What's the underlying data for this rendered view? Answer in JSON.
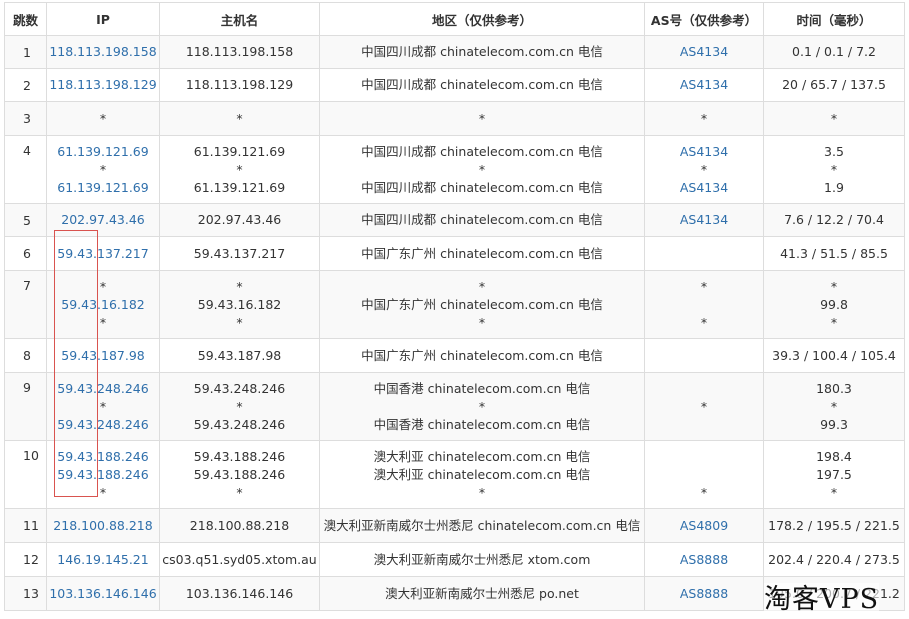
{
  "headers": {
    "hop": "跳数",
    "ip": "IP",
    "host": "主机名",
    "region": "地区（仅供参考）",
    "asn": "AS号（仅供参考）",
    "time": "时间（毫秒）"
  },
  "rows": [
    {
      "hop": "1",
      "ips": [
        "118.113.198.158"
      ],
      "hosts": [
        "118.113.198.158"
      ],
      "regions": [
        "中国四川成都 chinatelecom.com.cn 电信"
      ],
      "asns": [
        "AS4134"
      ],
      "times": [
        "0.1 / 0.1 / 7.2"
      ]
    },
    {
      "hop": "2",
      "ips": [
        "118.113.198.129"
      ],
      "hosts": [
        "118.113.198.129"
      ],
      "regions": [
        "中国四川成都 chinatelecom.com.cn 电信"
      ],
      "asns": [
        "AS4134"
      ],
      "times": [
        "20 / 65.7 / 137.5"
      ]
    },
    {
      "hop": "3",
      "ips": [
        "*"
      ],
      "hosts": [
        "*"
      ],
      "regions": [
        "*"
      ],
      "asns": [
        "*"
      ],
      "times": [
        "*"
      ]
    },
    {
      "hop": "4",
      "ips": [
        "61.139.121.69",
        "*",
        "61.139.121.69"
      ],
      "hosts": [
        "61.139.121.69",
        "*",
        "61.139.121.69"
      ],
      "regions": [
        "中国四川成都 chinatelecom.com.cn 电信",
        "*",
        "中国四川成都 chinatelecom.com.cn 电信"
      ],
      "asns": [
        "AS4134",
        "*",
        "AS4134"
      ],
      "times": [
        "3.5",
        "*",
        "1.9"
      ]
    },
    {
      "hop": "5",
      "ips": [
        "202.97.43.46"
      ],
      "hosts": [
        "202.97.43.46"
      ],
      "regions": [
        "中国四川成都 chinatelecom.com.cn 电信"
      ],
      "asns": [
        "AS4134"
      ],
      "times": [
        "7.6 / 12.2 / 70.4"
      ]
    },
    {
      "hop": "6",
      "ips": [
        "59.43.137.217"
      ],
      "hosts": [
        "59.43.137.217"
      ],
      "regions": [
        "中国广东广州 chinatelecom.com.cn 电信"
      ],
      "asns": [
        ""
      ],
      "times": [
        "41.3 / 51.5 / 85.5"
      ]
    },
    {
      "hop": "7",
      "ips": [
        "*",
        "59.43.16.182",
        "*"
      ],
      "hosts": [
        "*",
        "59.43.16.182",
        "*"
      ],
      "regions": [
        "*",
        "中国广东广州 chinatelecom.com.cn 电信",
        "*"
      ],
      "asns": [
        "*",
        "",
        "*"
      ],
      "times": [
        "*",
        "99.8",
        "*"
      ]
    },
    {
      "hop": "8",
      "ips": [
        "59.43.187.98"
      ],
      "hosts": [
        "59.43.187.98"
      ],
      "regions": [
        "中国广东广州 chinatelecom.com.cn 电信"
      ],
      "asns": [
        ""
      ],
      "times": [
        "39.3 / 100.4 / 105.4"
      ]
    },
    {
      "hop": "9",
      "ips": [
        "59.43.248.246",
        "*",
        "59.43.248.246"
      ],
      "hosts": [
        "59.43.248.246",
        "*",
        "59.43.248.246"
      ],
      "regions": [
        "中国香港 chinatelecom.com.cn 电信",
        "*",
        "中国香港 chinatelecom.com.cn 电信"
      ],
      "asns": [
        "",
        "*",
        ""
      ],
      "times": [
        "180.3",
        "*",
        "99.3"
      ]
    },
    {
      "hop": "10",
      "ips": [
        "59.43.188.246",
        "59.43.188.246",
        "*"
      ],
      "hosts": [
        "59.43.188.246",
        "59.43.188.246",
        "*"
      ],
      "regions": [
        "澳大利亚 chinatelecom.com.cn 电信",
        "澳大利亚 chinatelecom.com.cn 电信",
        "*"
      ],
      "asns": [
        "",
        "",
        "*"
      ],
      "times": [
        "198.4",
        "197.5",
        "*"
      ]
    },
    {
      "hop": "11",
      "ips": [
        "218.100.88.218"
      ],
      "hosts": [
        "218.100.88.218"
      ],
      "regions": [
        "澳大利亚新南威尔士州悉尼 chinatelecom.com.cn 电信"
      ],
      "asns": [
        "AS4809"
      ],
      "times": [
        "178.2 / 195.5 / 221.5"
      ]
    },
    {
      "hop": "12",
      "ips": [
        "146.19.145.21"
      ],
      "hosts": [
        "cs03.q51.syd05.xtom.au"
      ],
      "regions": [
        "澳大利亚新南威尔士州悉尼 xtom.com"
      ],
      "asns": [
        "AS8888"
      ],
      "times": [
        "202.4 / 220.4 / 273.5"
      ]
    },
    {
      "hop": "13",
      "ips": [
        "103.136.146.146"
      ],
      "hosts": [
        "103.136.146.146"
      ],
      "regions": [
        "澳大利亚新南威尔士州悉尼 po.net"
      ],
      "asns": [
        "AS8888"
      ],
      "times": [
        "195.0 / 200.7 / 221.2"
      ]
    }
  ],
  "watermark": "淘客VPS",
  "colors": {
    "link": "#2f6fab",
    "border": "#dddddd",
    "stripe": "#f9f9f9",
    "highlight": "#d9534f"
  }
}
